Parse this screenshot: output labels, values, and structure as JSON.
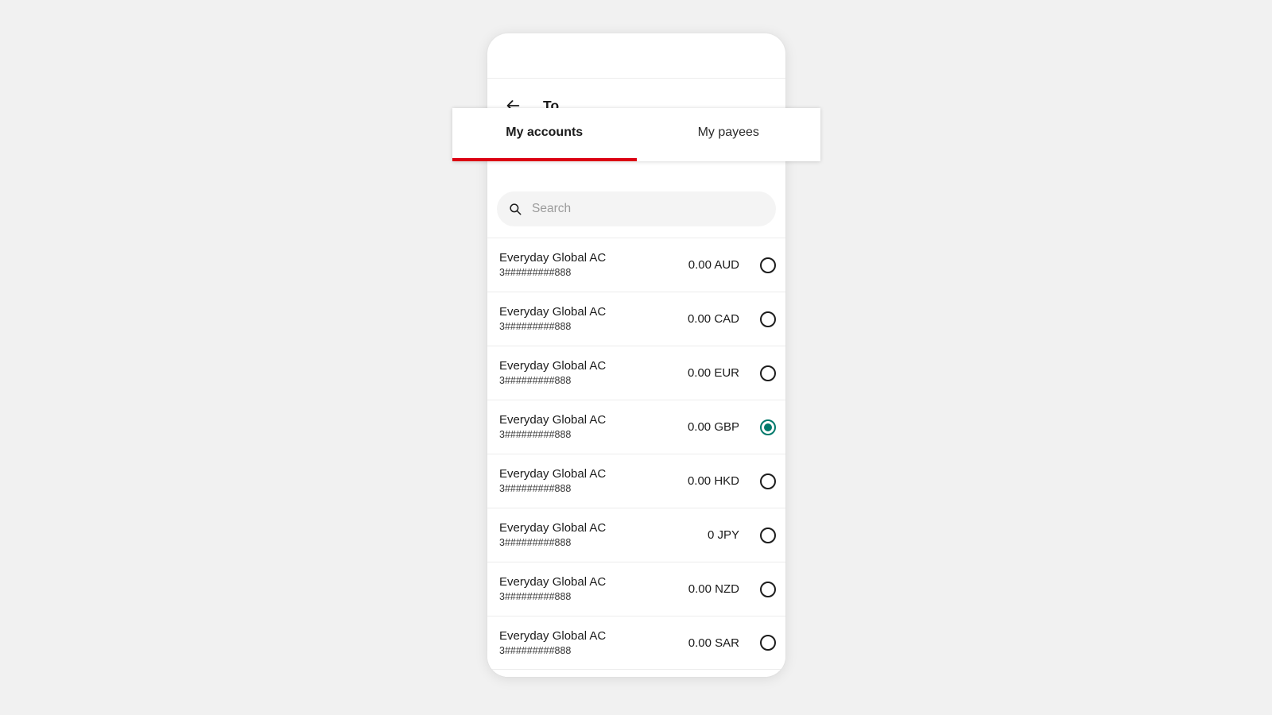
{
  "app": {
    "screen_title": "To",
    "back_icon": "arrow-left-icon"
  },
  "tabs": [
    {
      "label": "My accounts",
      "active": true
    },
    {
      "label": "My payees",
      "active": false
    }
  ],
  "search": {
    "icon": "search-icon",
    "placeholder": "Search",
    "value": ""
  },
  "colors": {
    "tab_indicator": "#db0011",
    "selected_radio": "#00796b",
    "page_background": "#f1f1f1"
  },
  "accounts": [
    {
      "name": "Everyday Global AC",
      "number": "3#########888",
      "balance": "0.00 AUD",
      "selected": false
    },
    {
      "name": "Everyday Global AC",
      "number": "3#########888",
      "balance": "0.00 CAD",
      "selected": false
    },
    {
      "name": "Everyday Global AC",
      "number": "3#########888",
      "balance": "0.00 EUR",
      "selected": false
    },
    {
      "name": "Everyday Global AC",
      "number": "3#########888",
      "balance": "0.00 GBP",
      "selected": true
    },
    {
      "name": "Everyday Global AC",
      "number": "3#########888",
      "balance": "0.00 HKD",
      "selected": false
    },
    {
      "name": "Everyday Global AC",
      "number": "3#########888",
      "balance": "0 JPY",
      "selected": false
    },
    {
      "name": "Everyday Global AC",
      "number": "3#########888",
      "balance": "0.00 NZD",
      "selected": false
    },
    {
      "name": "Everyday Global AC",
      "number": "3#########888",
      "balance": "0.00 SAR",
      "selected": false
    }
  ]
}
